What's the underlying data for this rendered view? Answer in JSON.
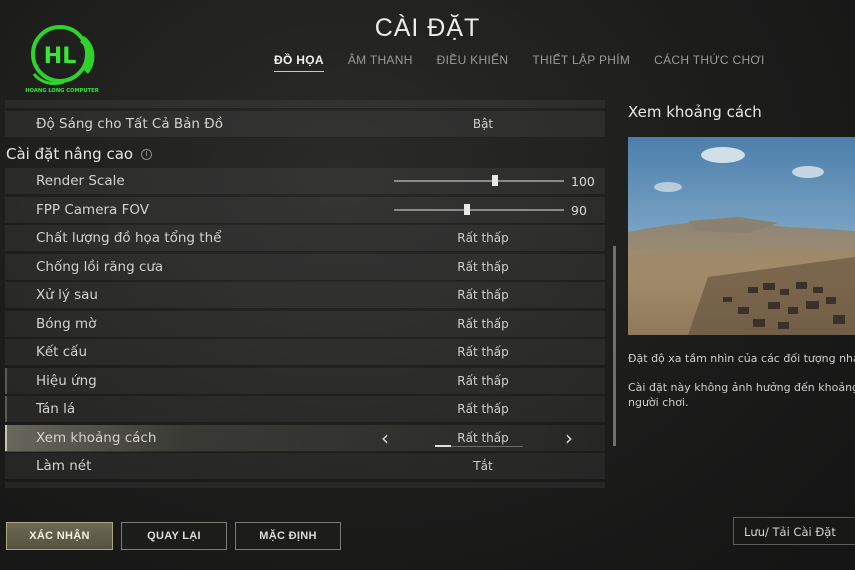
{
  "logo": {
    "text": "HL",
    "caption": "HOANG LONG COMPUTER"
  },
  "page_title": "CÀI ĐẶT",
  "tabs": [
    {
      "label": "ĐỒ HỌA"
    },
    {
      "label": "ÂM THANH"
    },
    {
      "label": "ĐIỀU KHIỂN"
    },
    {
      "label": "THIẾT LẬP PHÍM"
    },
    {
      "label": "CÁCH THỨC CHƠI"
    }
  ],
  "settings": {
    "brightness": {
      "label": "Độ Sáng cho Tất Cả Bản Đồ",
      "value": "Bật"
    },
    "advanced_title": "Cài đặt nâng cao",
    "info_glyph": "i",
    "render_scale": {
      "label": "Render Scale",
      "value": "100",
      "level": 100,
      "min": 70,
      "max": 120
    },
    "fpp_fov": {
      "label": "FPP Camera FOV",
      "value": "90",
      "level": 90,
      "min": 80,
      "max": 103
    },
    "overall_quality": {
      "label": "Chất lượng đồ họa tổng thể",
      "value": "Rất thấp"
    },
    "anti_aliasing": {
      "label": "Chống lồi răng cưa",
      "value": "Rất thấp"
    },
    "post_processing": {
      "label": "Xử lý sau",
      "value": "Rất thấp"
    },
    "shadows": {
      "label": "Bóng mờ",
      "value": "Rất thấp"
    },
    "textures": {
      "label": "Kết cấu",
      "value": "Rất thấp"
    },
    "effects": {
      "label": "Hiệu ứng",
      "value": "Rất thấp"
    },
    "foliage": {
      "label": "Tán lá",
      "value": "Rất thấp"
    },
    "view_distance": {
      "label": "Xem khoảng cách",
      "value": "Rất thấp",
      "left_arrow": "‹",
      "right_arrow": "›"
    },
    "sharpen": {
      "label": "Làm nét",
      "value": "Tắt"
    }
  },
  "detail": {
    "title": "Xem khoảng cách",
    "desc1": "Đặt độ xa tầm nhìn của các đối tượng nhất đ",
    "desc2a": "Cài đặt này không ảnh hưởng đến khoảng các",
    "desc2b": "người chơi."
  },
  "buttons": {
    "confirm": "XÁC NHẬN",
    "back": "QUAY LẠI",
    "default": "MẶC ĐỊNH",
    "save_load": "Lưu/ Tải Cài Đặt"
  }
}
